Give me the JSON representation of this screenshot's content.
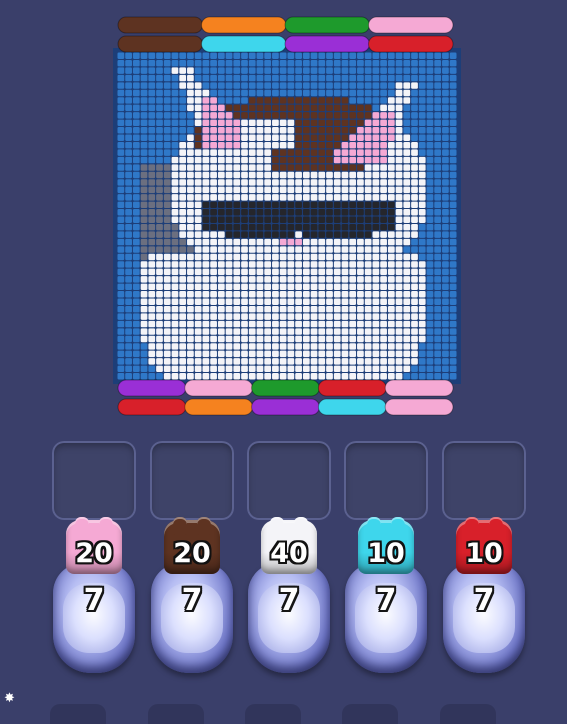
{
  "colors": {
    "background": "#3a3f6a",
    "board_blue": "#2f78c8",
    "pink": "#f5a9d4",
    "brown": "#5e3321",
    "white": "#f4f4f8",
    "cyan": "#3ed6ec",
    "red": "#d8202a",
    "orange": "#f5821f",
    "green": "#1e9a2c",
    "purple": "#9a2fd6"
  },
  "board": {
    "top_ropes": [
      [
        "brown",
        "orange",
        "green",
        "pink"
      ],
      [
        "brown",
        "cyan",
        "purple",
        "red"
      ]
    ],
    "bottom_ropes": [
      [
        "purple",
        "pink",
        "green",
        "red",
        "pink"
      ],
      [
        "red",
        "orange",
        "purple",
        "cyan",
        "pink"
      ]
    ]
  },
  "slots": [
    {
      "state": "empty"
    },
    {
      "state": "empty"
    },
    {
      "state": "empty"
    },
    {
      "state": "empty"
    },
    {
      "state": "empty"
    }
  ],
  "spools": [
    {
      "color": "pink",
      "count": "20",
      "pod_count": "7"
    },
    {
      "color": "brown",
      "count": "20",
      "pod_count": "7"
    },
    {
      "color": "white",
      "count": "40",
      "pod_count": "7"
    },
    {
      "color": "cyan",
      "count": "10",
      "pod_count": "7"
    },
    {
      "color": "red",
      "count": "10",
      "pod_count": "7"
    }
  ],
  "icons": {
    "settings": "gear-icon"
  }
}
